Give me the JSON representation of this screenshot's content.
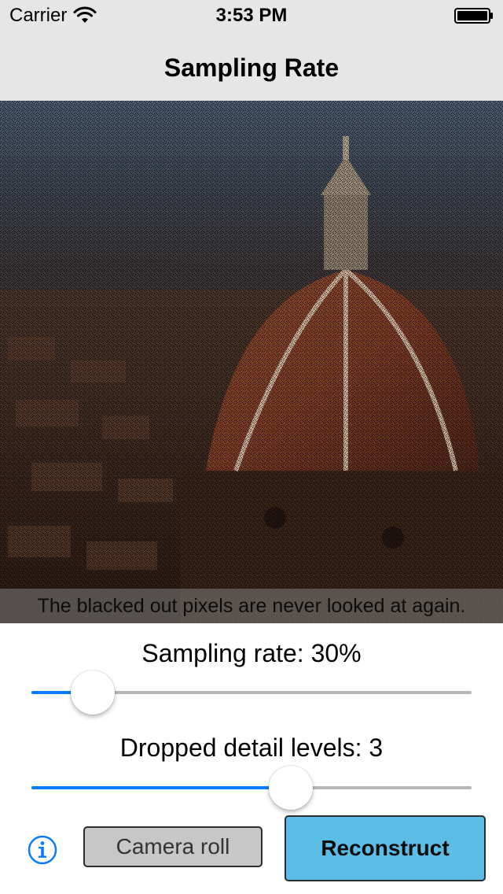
{
  "status_bar": {
    "carrier": "Carrier",
    "time": "3:53 PM"
  },
  "nav": {
    "title": "Sampling Rate"
  },
  "photo": {
    "caption": "The blacked out pixels are never looked at again."
  },
  "sampling_slider": {
    "label": "Sampling rate: 30%",
    "value_fraction": 0.14
  },
  "detail_slider": {
    "label": "Dropped detail levels: 3",
    "value_fraction": 0.59
  },
  "toolbar": {
    "info_icon": "info-icon",
    "camera_roll_label": "Camera roll",
    "reconstruct_label": "Reconstruct"
  },
  "colors": {
    "nav_background": "#e6e6e6",
    "slider_fill": "#0a7afe",
    "slider_track": "#b7b7b7",
    "info_tint": "#0a7afe",
    "camera_button": "#c7c7c7",
    "reconstruct_button": "#5bbde6"
  }
}
